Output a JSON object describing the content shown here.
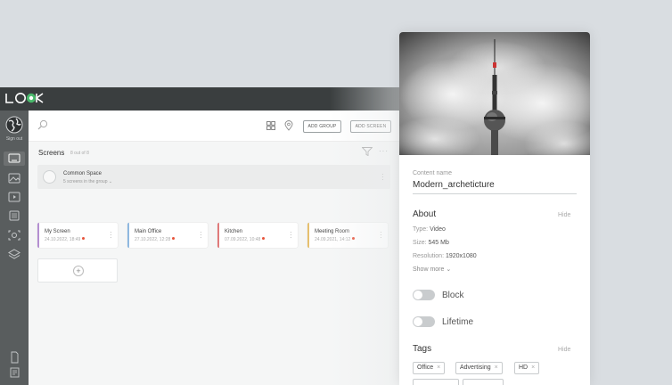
{
  "sidebar": {
    "sign_out": "Sign out",
    "icons": [
      "screens-icon",
      "gallery-icon",
      "playlist-icon",
      "list-icon",
      "scan-icon",
      "layers-icon",
      "document-icon",
      "notes-icon"
    ]
  },
  "toolbar": {
    "add_group": "ADD GROUP",
    "add_screen": "ADD SCREEN"
  },
  "screens": {
    "title": "Screens",
    "count": "8 out of 8",
    "group": {
      "name": "Common Space",
      "subtitle": "5 screens in the group"
    },
    "cards": [
      {
        "name": "My Screen",
        "time": "24.10.2022, 18:49",
        "color": "#b48fd1"
      },
      {
        "name": "Main Office",
        "time": "27.10.2022, 12:28",
        "color": "#8fb8e0"
      },
      {
        "name": "Kitchen",
        "time": "07.09.2022, 10:48",
        "color": "#e07a7a"
      },
      {
        "name": "Meeting Room",
        "time": "24.09.2021, 14:12",
        "color": "#e6c06e"
      }
    ],
    "status_dot_color": "#e8533a"
  },
  "panel": {
    "content_name_label": "Content name",
    "content_name": "Modern_archeticture",
    "about": {
      "title": "About",
      "hide": "Hide",
      "type_label": "Type:",
      "type": "Video",
      "size_label": "Size:",
      "size": "545 Mb",
      "resolution_label": "Resolution:",
      "resolution": "1920x1080",
      "show_more": "Show more"
    },
    "block_label": "Block",
    "lifetime_label": "Lifetime",
    "tags": {
      "title": "Tags",
      "hide": "Hide",
      "items": [
        "Office",
        "Advertising",
        "HD"
      ]
    }
  }
}
